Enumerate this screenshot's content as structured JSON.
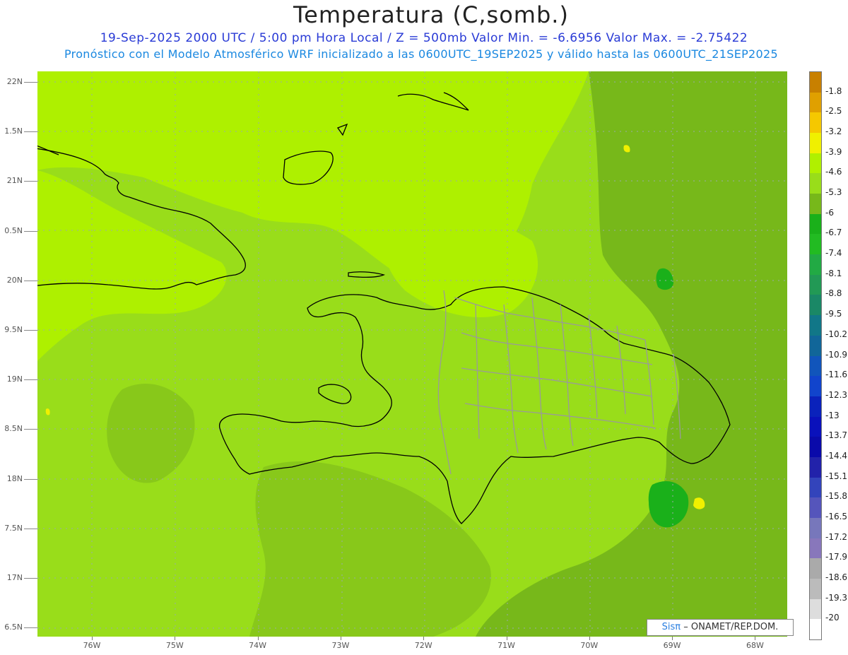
{
  "header": {
    "title": "Temperatura (C,somb.)",
    "subtitle": "19-Sep-2025  2000 UTC / 5:00 pm Hora Local / Z = 500mb   Valor Min. = -6.6956  Valor Max. = -2.75422",
    "subtitle2": "Pronóstico con el Modelo Atmosférico WRF inicializado a las 0600UTC_19SEP2025 y válido hasta las  0600UTC_21SEP2025"
  },
  "map": {
    "lat_labels": [
      "22N",
      "1.5N",
      "21N",
      "0.5N",
      "20N",
      "9.5N",
      "19N",
      "8.5N",
      "18N",
      "7.5N",
      "17N",
      "6.5N"
    ],
    "lon_labels": [
      "76W",
      "75W",
      "74W",
      "73W",
      "72W",
      "71W",
      "70W",
      "69W",
      "68W"
    ],
    "lat_range": [
      16.5,
      22
    ],
    "lon_range": [
      -76.7,
      -67.6
    ],
    "min_value": -6.6956,
    "max_value": -2.75422
  },
  "colorbar": {
    "labels": [
      "-1.8",
      "-2.5",
      "-3.2",
      "-3.9",
      "-4.6",
      "-5.3",
      "-6",
      "-6.7",
      "-7.4",
      "-8.1",
      "-8.8",
      "-9.5",
      "-10.2",
      "-10.9",
      "-11.6",
      "-12.3",
      "-13",
      "-13.7",
      "-14.4",
      "-15.1",
      "-15.8",
      "-16.5",
      "-17.2",
      "-17.9",
      "-18.6",
      "-19.3",
      "-20"
    ],
    "colors": [
      "#c88000",
      "#e0a000",
      "#f5c800",
      "#f0f000",
      "#b0f000",
      "#99dd1a",
      "#77b81a",
      "#1ab01a",
      "#22bb22",
      "#22aa44",
      "#229955",
      "#1a8866",
      "#117788",
      "#116699",
      "#1155bb",
      "#1144cc",
      "#0a22bb",
      "#0a11bb",
      "#0a0aaa",
      "#2222aa",
      "#3344bb",
      "#5555bb",
      "#7777bb",
      "#8877bb",
      "#aaaaaa",
      "#bbbbbb",
      "#dddddd",
      "#ffffff"
    ]
  },
  "credit": {
    "sis": "Sisπ",
    "org": "– ONAMET/REP.DOM."
  }
}
